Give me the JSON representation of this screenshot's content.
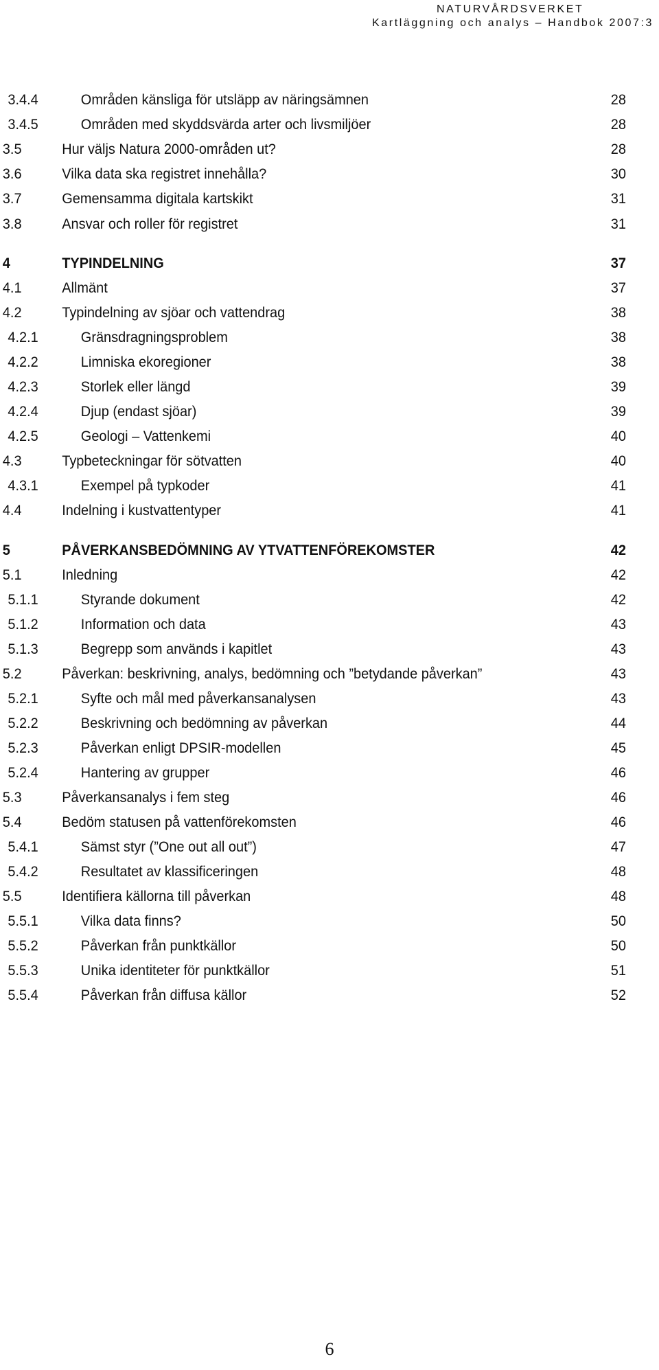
{
  "header": {
    "org": "NATURVÅRDSVERKET",
    "subtitle": "Kartläggning och analys – Handbok 2007:3"
  },
  "toc": [
    {
      "level": 3,
      "num": "3.4.4",
      "title": "Områden känsliga för utsläpp av näringsämnen",
      "page": "28"
    },
    {
      "level": 3,
      "num": "3.4.5",
      "title": "Områden med skyddsvärda arter och livsmiljöer",
      "page": "28"
    },
    {
      "level": 2,
      "num": "3.5",
      "title": "Hur väljs Natura 2000-områden ut?",
      "page": "28"
    },
    {
      "level": 2,
      "num": "3.6",
      "title": "Vilka data ska registret innehålla?",
      "page": "30"
    },
    {
      "level": 2,
      "num": "3.7",
      "title": "Gemensamma digitala kartskikt",
      "page": "31"
    },
    {
      "level": 2,
      "num": "3.8",
      "title": "Ansvar och roller för registret",
      "page": "31"
    },
    {
      "level": 1,
      "num": "4",
      "title": "TYPINDELNING",
      "page": "37"
    },
    {
      "level": 2,
      "num": "4.1",
      "title": "Allmänt",
      "page": "37"
    },
    {
      "level": 2,
      "num": "4.2",
      "title": "Typindelning av sjöar och vattendrag",
      "page": "38"
    },
    {
      "level": 3,
      "num": "4.2.1",
      "title": "Gränsdragningsproblem",
      "page": "38"
    },
    {
      "level": 3,
      "num": "4.2.2",
      "title": "Limniska ekoregioner",
      "page": "38"
    },
    {
      "level": 3,
      "num": "4.2.3",
      "title": "Storlek eller längd",
      "page": "39"
    },
    {
      "level": 3,
      "num": "4.2.4",
      "title": "Djup (endast sjöar)",
      "page": "39"
    },
    {
      "level": 3,
      "num": "4.2.5",
      "title": "Geologi – Vattenkemi",
      "page": "40"
    },
    {
      "level": 2,
      "num": "4.3",
      "title": "Typbeteckningar för sötvatten",
      "page": "40"
    },
    {
      "level": 3,
      "num": "4.3.1",
      "title": "Exempel på typkoder",
      "page": "41"
    },
    {
      "level": 2,
      "num": "4.4",
      "title": "Indelning i kustvattentyper",
      "page": "41"
    },
    {
      "level": 1,
      "num": "5",
      "title": "PÅVERKANSBEDÖMNING AV  YTVATTENFÖREKOMSTER",
      "page": "42"
    },
    {
      "level": 2,
      "num": "5.1",
      "title": "Inledning",
      "page": "42"
    },
    {
      "level": 3,
      "num": "5.1.1",
      "title": "Styrande dokument",
      "page": "42"
    },
    {
      "level": 3,
      "num": "5.1.2",
      "title": "Information och data",
      "page": "43"
    },
    {
      "level": 3,
      "num": "5.1.3",
      "title": "Begrepp som används i kapitlet",
      "page": "43"
    },
    {
      "level": 2,
      "num": "5.2",
      "title": "Påverkan: beskrivning, analys, bedömning och ”betydande påverkan”",
      "page": "43"
    },
    {
      "level": 3,
      "num": "5.2.1",
      "title": "Syfte och mål med påverkansanalysen",
      "page": "43"
    },
    {
      "level": 3,
      "num": "5.2.2",
      "title": "Beskrivning och bedömning av påverkan",
      "page": "44"
    },
    {
      "level": 3,
      "num": "5.2.3",
      "title": "Påverkan enligt DPSIR-modellen",
      "page": "45"
    },
    {
      "level": 3,
      "num": "5.2.4",
      "title": "Hantering av grupper",
      "page": "46"
    },
    {
      "level": 2,
      "num": "5.3",
      "title": "Påverkansanalys i fem steg",
      "page": "46"
    },
    {
      "level": 2,
      "num": "5.4",
      "title": "Bedöm statusen på vattenförekomsten",
      "page": "46"
    },
    {
      "level": 3,
      "num": "5.4.1",
      "title": "Sämst styr (”One out all out”)",
      "page": "47"
    },
    {
      "level": 3,
      "num": "5.4.2",
      "title": "Resultatet av klassificeringen",
      "page": "48"
    },
    {
      "level": 2,
      "num": "5.5",
      "title": "Identifiera källorna till påverkan",
      "page": "48"
    },
    {
      "level": 3,
      "num": "5.5.1",
      "title": "Vilka data finns?",
      "page": "50"
    },
    {
      "level": 3,
      "num": "5.5.2",
      "title": "Påverkan från punktkällor",
      "page": "50"
    },
    {
      "level": 3,
      "num": "5.5.3",
      "title": "Unika identiteter för punktkällor",
      "page": "51"
    },
    {
      "level": 3,
      "num": "5.5.4",
      "title": "Påverkan från diffusa källor",
      "page": "52"
    }
  ],
  "footer": {
    "page_number": "6"
  }
}
